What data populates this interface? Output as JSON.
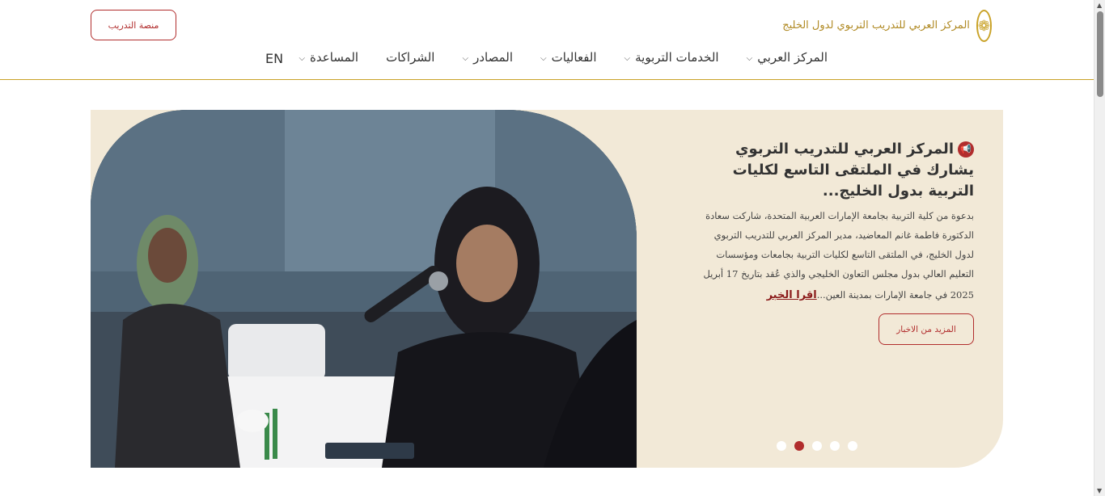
{
  "header": {
    "logo_text": "المركز العربي للتدريب التربوي لدول الخليج",
    "logo_icon": "emblem-icon",
    "training_button": "منصة التدريب"
  },
  "nav": {
    "items": [
      {
        "label": "المركز العربي",
        "has_dropdown": true
      },
      {
        "label": "الخدمات التربوية",
        "has_dropdown": true
      },
      {
        "label": "الفعاليات",
        "has_dropdown": true
      },
      {
        "label": "المصادر",
        "has_dropdown": true
      },
      {
        "label": "الشراكات",
        "has_dropdown": false
      },
      {
        "label": "المساعدة",
        "has_dropdown": true
      }
    ],
    "language": "EN"
  },
  "hero": {
    "headline": "المركز العربي للتدريب التربوي يشارك في الملتقى التاسع لكليات التربية بدول الخليج...",
    "body": "بدعوة من كلية التربية بجامعة الإمارات العربية المتحدة، شاركت سعادة الدكتورة فاطمة غانم المعاضيد، مدير المركز العربي للتدريب التربوي لدول الخليج، في الملتقى التاسع لكليات التربية بجامعات ومؤسسات التعليم العالي بدول مجلس التعاون الخليجي والذي عُقد بتاريخ 17 أبريل 2025 في جامعة الإمارات بمدينة العين...",
    "read_more": "اقرا الخبر",
    "more_news_button": "المزيد من الاخبار",
    "slides_total": 5,
    "active_slide": 2
  },
  "colors": {
    "accent": "#b12d2d",
    "gold": "#c9a227",
    "hero_bg": "#f2e9d7"
  }
}
